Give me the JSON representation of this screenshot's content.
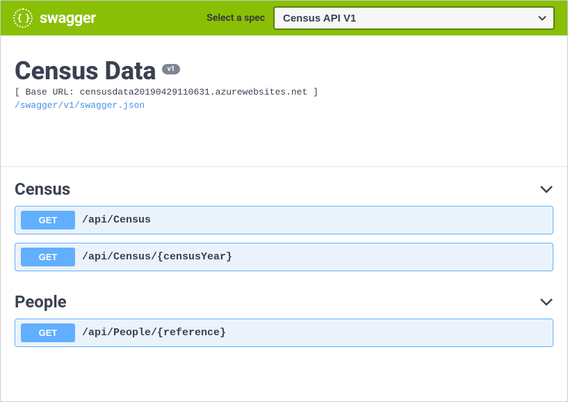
{
  "topbar": {
    "logo_text": "swagger",
    "spec_label": "Select a spec",
    "spec_selected": "Census API V1"
  },
  "info": {
    "title": "Census Data",
    "version": "v1",
    "base_url": "[ Base URL: censusdata20190429110631.azurewebsites.net ]",
    "swagger_link": "/swagger/v1/swagger.json"
  },
  "tags": [
    {
      "name": "Census",
      "operations": [
        {
          "method": "GET",
          "path": "/api/Census"
        },
        {
          "method": "GET",
          "path": "/api/Census/{censusYear}"
        }
      ]
    },
    {
      "name": "People",
      "operations": [
        {
          "method": "GET",
          "path": "/api/People/{reference}"
        }
      ]
    }
  ]
}
